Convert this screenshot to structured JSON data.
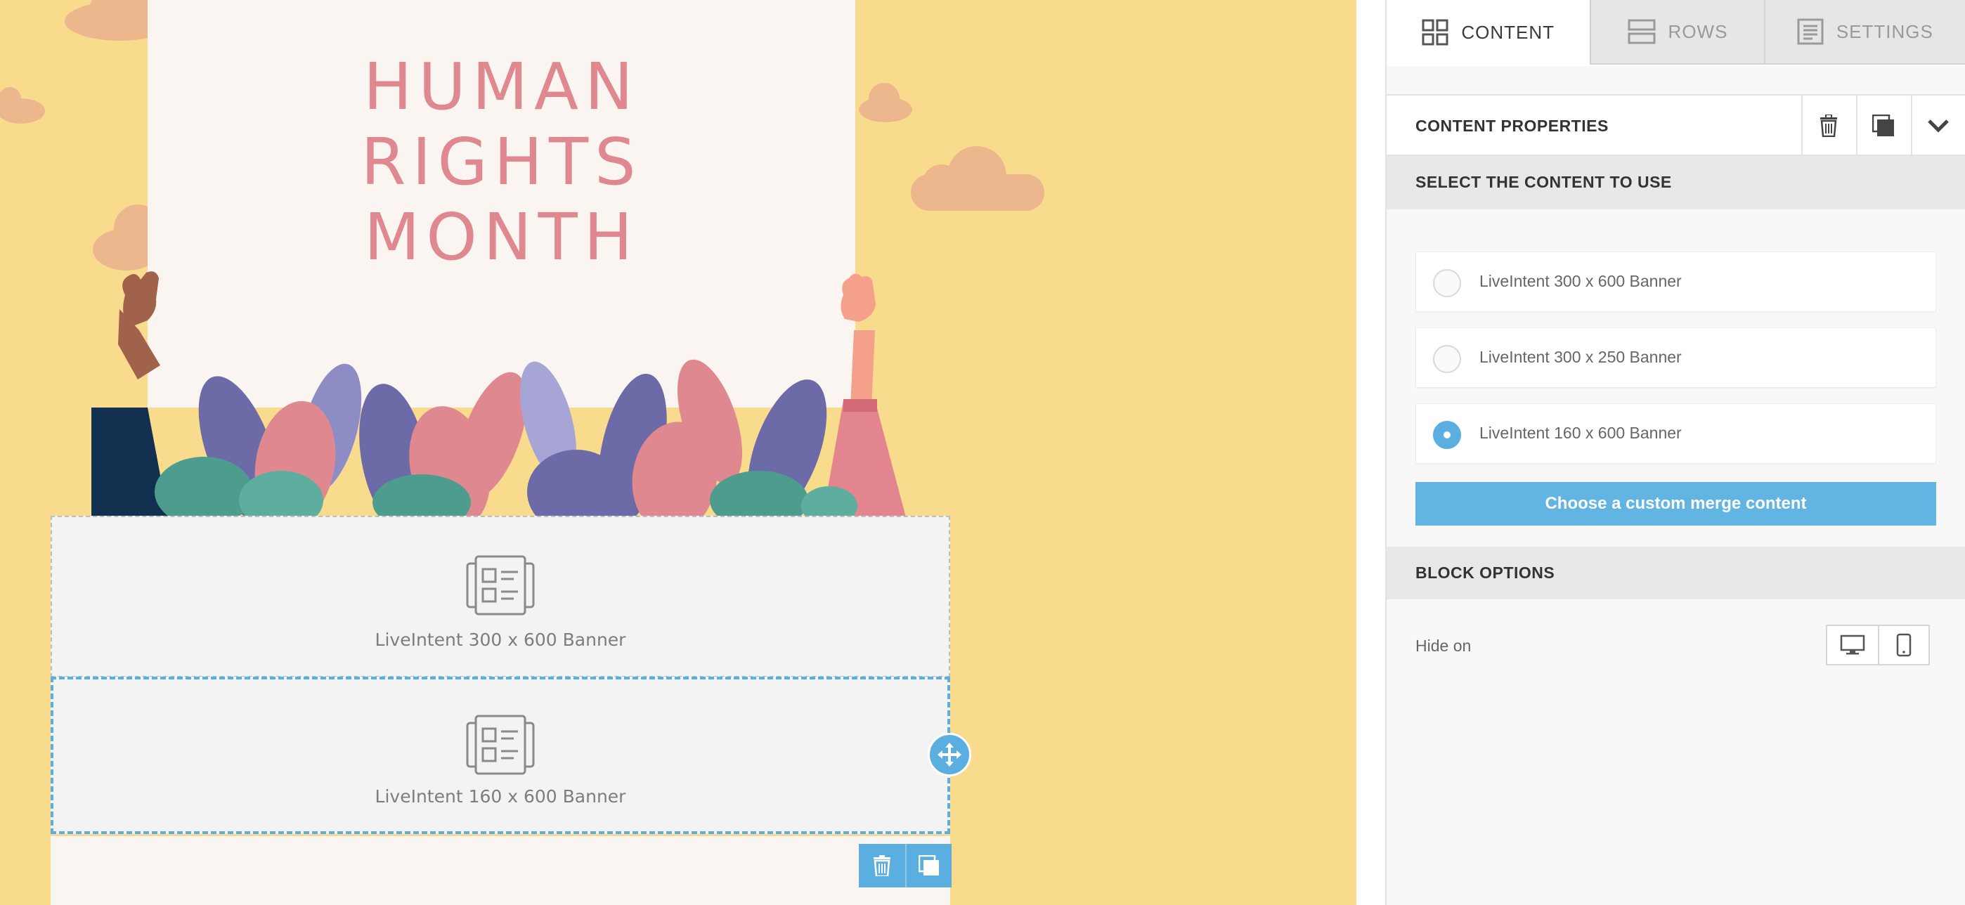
{
  "hero": {
    "title": "HUMAN\nRIGHTS\nMONTH"
  },
  "blocks": [
    {
      "label": "LiveIntent 300 x 600 Banner",
      "icon": "content-block-icon"
    },
    {
      "label": "LiveIntent 160 x 600 Banner",
      "icon": "content-block-icon",
      "selected": true
    }
  ],
  "block_toolbar": {
    "delete_icon": "trash-icon",
    "duplicate_icon": "duplicate-icon",
    "move_icon": "move-arrows-icon"
  },
  "sidebar": {
    "tabs": [
      {
        "label": "CONTENT",
        "icon": "grid-icon",
        "active": true
      },
      {
        "label": "ROWS",
        "icon": "rows-icon",
        "active": false
      },
      {
        "label": "SETTINGS",
        "icon": "settings-doc-icon",
        "active": false
      }
    ],
    "properties_title": "CONTENT PROPERTIES",
    "select_section_title": "SELECT THE CONTENT TO USE",
    "options": [
      {
        "label": "LiveIntent 300 x 600 Banner",
        "checked": false
      },
      {
        "label": "LiveIntent 300 x 250 Banner",
        "checked": false
      },
      {
        "label": "LiveIntent 160 x 600 Banner",
        "checked": true
      }
    ],
    "custom_merge_label": "Choose a custom merge content",
    "block_options_title": "BLOCK OPTIONS",
    "hide_on_label": "Hide on"
  },
  "colors": {
    "accent": "#5AAEE0",
    "canvas_bg": "#F9DB8D",
    "title_pink": "#E08890"
  }
}
